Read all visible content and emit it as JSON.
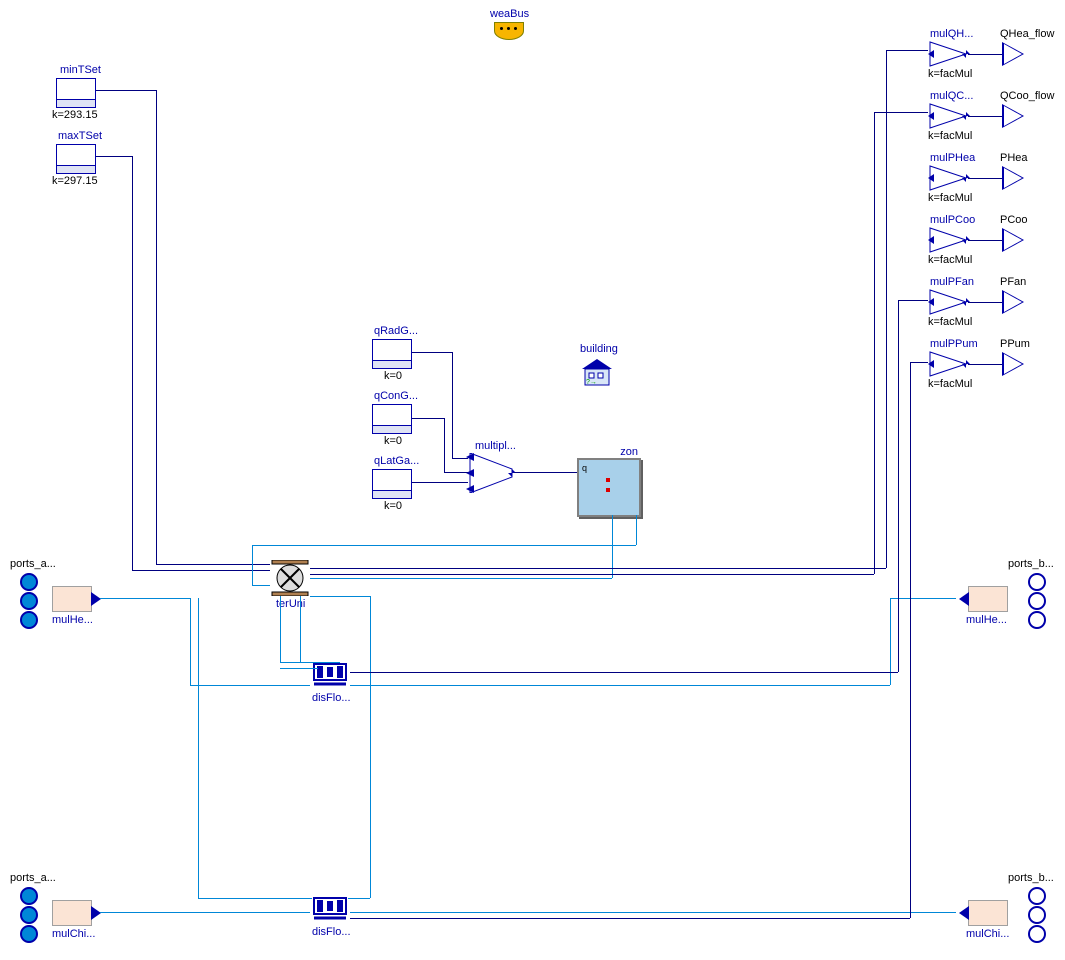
{
  "top": {
    "weaBus": "weaBus"
  },
  "left": {
    "minTSet": {
      "label": "minTSet",
      "k": "k=293.15"
    },
    "maxTSet": {
      "label": "maxTSet",
      "k": "k=297.15"
    }
  },
  "gains": {
    "qRad": {
      "label": "qRadG...",
      "k": "k=0"
    },
    "qCon": {
      "label": "qConG...",
      "k": "k=0"
    },
    "qLat": {
      "label": "qLatGa...",
      "k": "k=0"
    }
  },
  "mux": {
    "label": "multipl..."
  },
  "building": {
    "label": "building"
  },
  "zone": {
    "label": "zon",
    "q": "q"
  },
  "terUni": {
    "label": "terUni"
  },
  "disFloTop": {
    "label": "disFlo..."
  },
  "disFloBot": {
    "label": "disFlo..."
  },
  "portsLeft": {
    "top": {
      "label": "ports_a...",
      "mul": "mulHe..."
    },
    "bot": {
      "label": "ports_a...",
      "mul": "mulChi..."
    }
  },
  "portsRight": {
    "top": {
      "label": "ports_b...",
      "mul": "mulHe..."
    },
    "bot": {
      "label": "ports_b...",
      "mul": "mulChi..."
    }
  },
  "outputs": [
    {
      "name": "mulQH...",
      "k": "k=facMul",
      "out": "QHea_flow"
    },
    {
      "name": "mulQC...",
      "k": "k=facMul",
      "out": "QCoo_flow"
    },
    {
      "name": "mulPHea",
      "k": "k=facMul",
      "out": "PHea"
    },
    {
      "name": "mulPCoo",
      "k": "k=facMul",
      "out": "PCoo"
    },
    {
      "name": "mulPFan",
      "k": "k=facMul",
      "out": "PFan"
    },
    {
      "name": "mulPPum",
      "k": "k=facMul",
      "out": "PPum"
    }
  ]
}
